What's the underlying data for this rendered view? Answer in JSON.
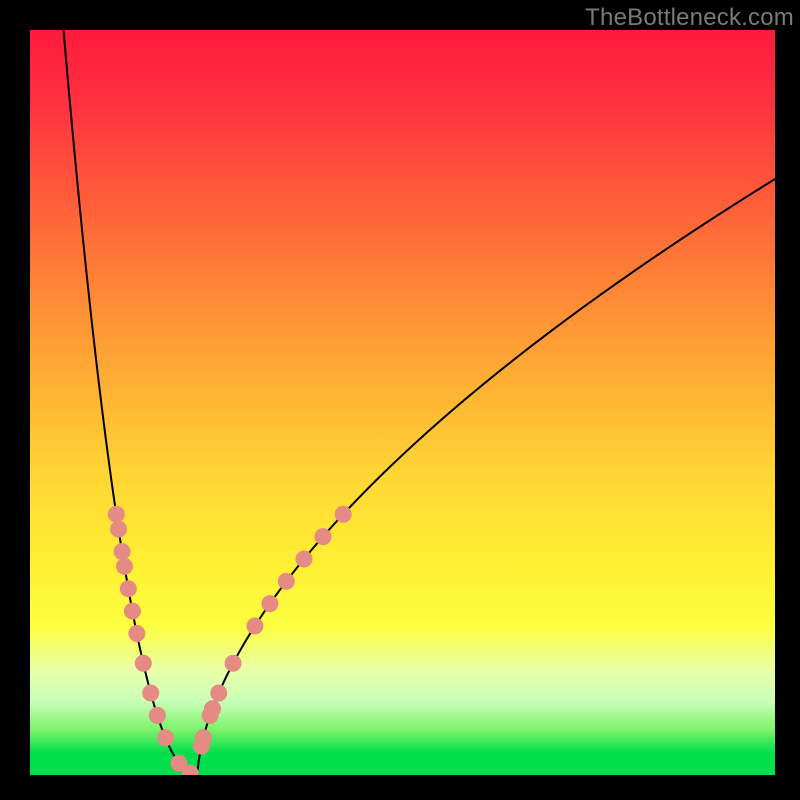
{
  "watermark": "TheBottleneck.com",
  "chart_data": {
    "type": "line",
    "title": "",
    "xlabel": "",
    "ylabel": "",
    "x_range": [
      0,
      100
    ],
    "y_range": [
      0,
      100
    ],
    "curve": {
      "min_x": 22.5,
      "left_start": {
        "x": 4.5,
        "y": 100
      },
      "right_end": {
        "x": 100,
        "y": 80
      },
      "left_exponent": 2.1,
      "right_exponent": 0.6
    },
    "markers_left_y": [
      35,
      33,
      30,
      28,
      25,
      22,
      19,
      15,
      11,
      8,
      5
    ],
    "markers_right_y": [
      35,
      32,
      29,
      26,
      23,
      20,
      15,
      11,
      8,
      5
    ],
    "markers_flat_x": [
      20.0,
      21.5,
      23.0,
      24.5
    ],
    "marker_radius": 8,
    "colors": {
      "curve": "#000000",
      "marker": "#e68a84",
      "gradient_top": "#ff1a3c",
      "gradient_bottom": "#00e04a"
    }
  }
}
